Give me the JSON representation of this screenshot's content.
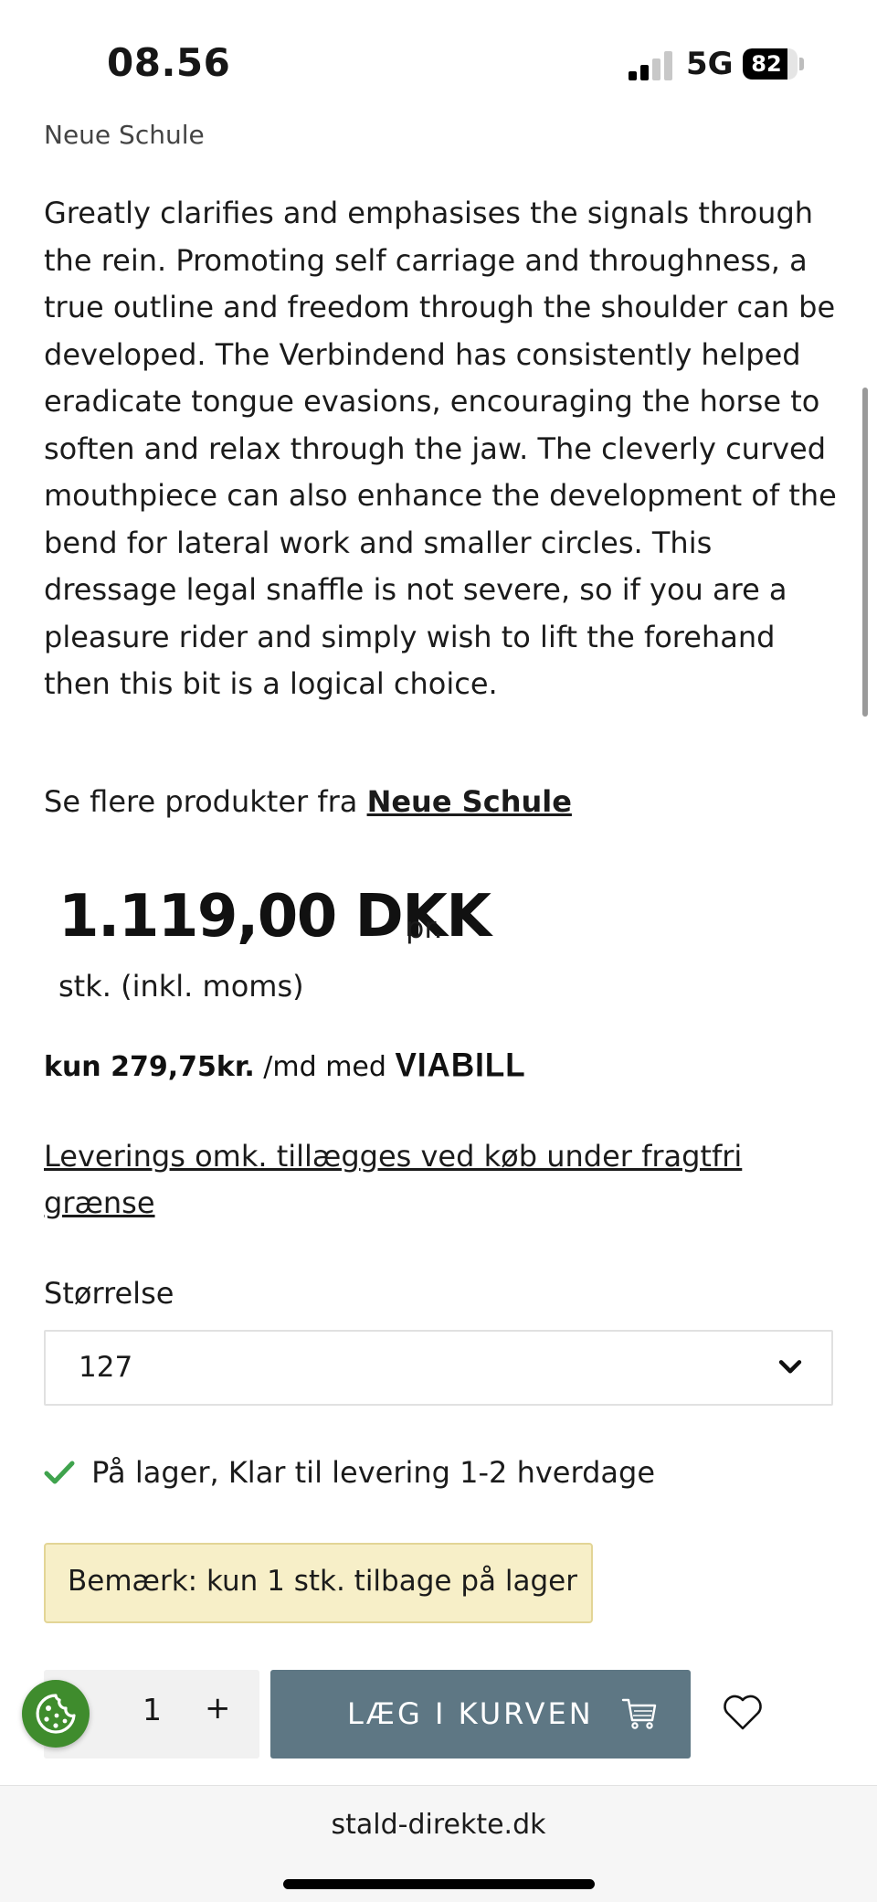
{
  "status_bar": {
    "time": "08.56",
    "network": "5G",
    "battery": 82
  },
  "brand_top": "Neue Schule",
  "description": "Greatly clarifies and emphasises the signals through the rein. Promoting self carriage and throughness, a true outline and freedom through the shoulder can be developed. The Verbindend has consistently helped eradicate tongue evasions, encouraging the horse to soften and relax through the jaw. The cleverly curved mouthpiece can also enhance the development of the bend for lateral work and smaller circles. This dressage legal snaffle is not severe, so if you are a pleasure rider and simply wish to lift the forehand then this bit is a logical choice.",
  "brand_line": {
    "prefix": "Se flere produkter fra",
    "link": "Neue Schule"
  },
  "price": {
    "amount": "1.119,00 DKK",
    "per": "pr.",
    "unit": "stk. (inkl. moms)"
  },
  "viabill": {
    "prefix": "kun 279,75kr.",
    "middle": "/md med",
    "logo": "VIABILL"
  },
  "delivery_link": "Leverings omk. tillægges ved køb under fragtfri grænse",
  "size": {
    "label": "Størrelse",
    "value": "127"
  },
  "stock": {
    "text": "På lager,",
    "delivery": "Klar til levering 1-2 hverdage"
  },
  "notice": "Bemærk: kun 1 stk. tilbage på lager",
  "quantity": {
    "minus": "-",
    "value": "1",
    "plus": "+"
  },
  "add_to_cart": "LÆG I KURVEN",
  "browser": {
    "url": "stald-direkte.dk"
  },
  "colors": {
    "accent_button": "#5e7784",
    "stock_green": "#3fa34d",
    "notice_bg": "#f7efc8",
    "cookie_green": "#3f8c2d"
  }
}
